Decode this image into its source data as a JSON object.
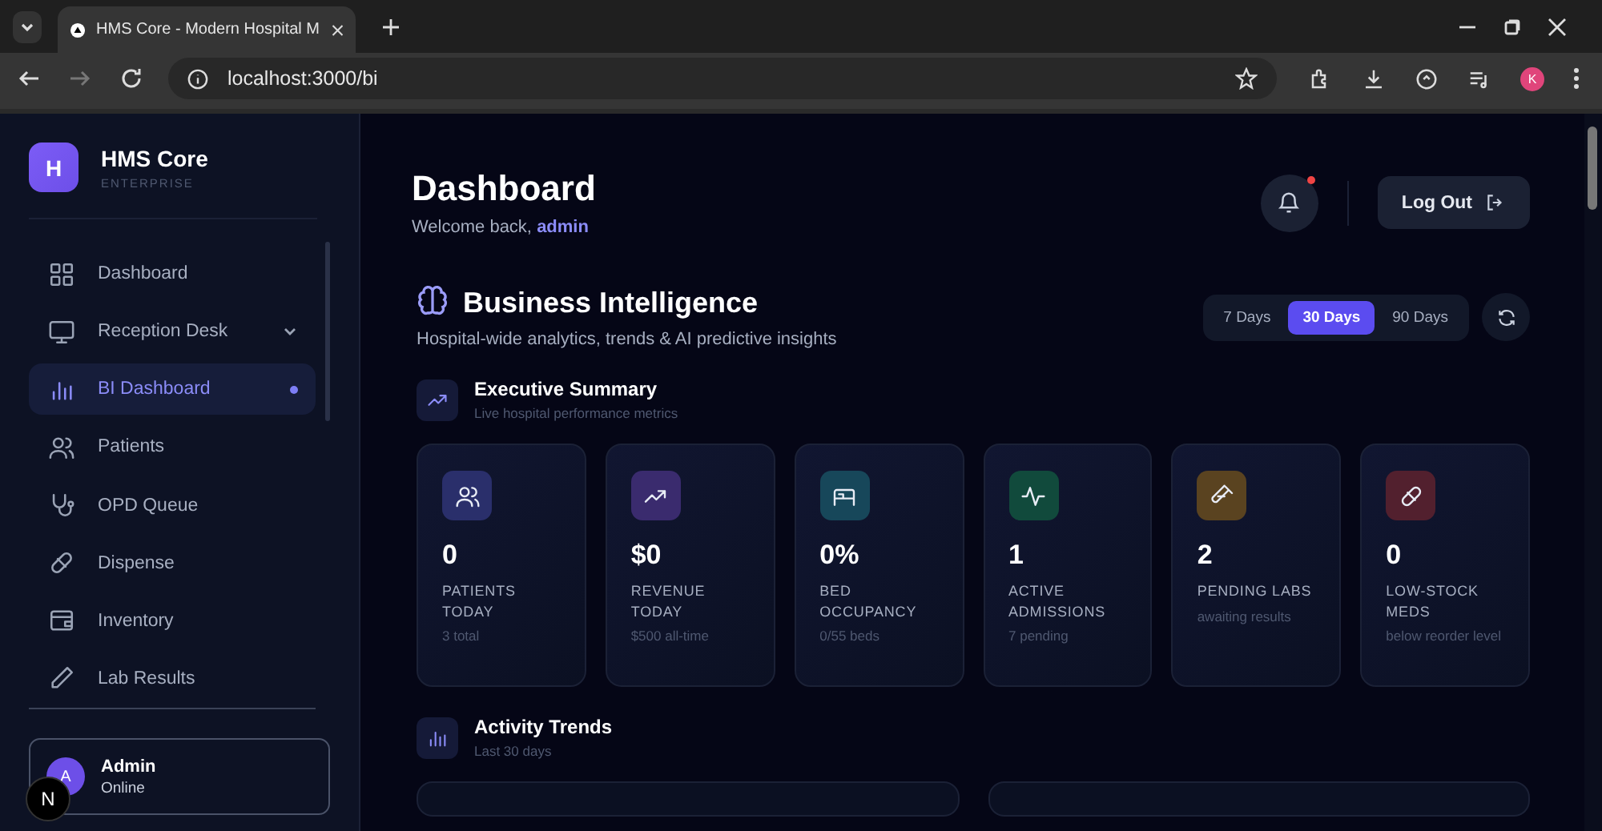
{
  "browser": {
    "tab_title": "HMS Core - Modern Hospital M",
    "url": "localhost:3000/bi",
    "profile_initial": "K"
  },
  "sidebar": {
    "logo_letter": "H",
    "brand": "HMS Core",
    "edition": "ENTERPRISE",
    "items": [
      {
        "label": "Dashboard",
        "selected": false,
        "expandable": false
      },
      {
        "label": "Reception Desk",
        "selected": false,
        "expandable": true
      },
      {
        "label": "BI Dashboard",
        "selected": true,
        "expandable": false
      },
      {
        "label": "Patients",
        "selected": false,
        "expandable": false
      },
      {
        "label": "OPD Queue",
        "selected": false,
        "expandable": false
      },
      {
        "label": "Dispense",
        "selected": false,
        "expandable": false
      },
      {
        "label": "Inventory",
        "selected": false,
        "expandable": false
      },
      {
        "label": "Lab Results",
        "selected": false,
        "expandable": false
      }
    ],
    "user": {
      "initial": "A",
      "name": "Admin",
      "status": "Online"
    },
    "dev_badge": "N"
  },
  "header": {
    "title": "Dashboard",
    "welcome": "Welcome back, ",
    "username": "admin",
    "notification": true,
    "logout": "Log Out"
  },
  "bi": {
    "title": "Business Intelligence",
    "subtitle": "Hospital-wide analytics, trends & AI predictive insights",
    "ranges": [
      {
        "label": "7 Days",
        "selected": false
      },
      {
        "label": "30 Days",
        "selected": true
      },
      {
        "label": "90 Days",
        "selected": false
      }
    ]
  },
  "executive_summary": {
    "title": "Executive Summary",
    "subtitle": "Live hospital performance metrics",
    "cards": [
      {
        "value": "0",
        "label": "PATIENTS TODAY",
        "note": "3 total"
      },
      {
        "value": "$0",
        "label": "REVENUE TODAY",
        "note": "$500 all-time"
      },
      {
        "value": "0%",
        "label": "BED OCCUPANCY",
        "note": "0/55 beds"
      },
      {
        "value": "1",
        "label": "ACTIVE ADMISSIONS",
        "note": "7 pending"
      },
      {
        "value": "2",
        "label": "PENDING LABS",
        "note": "awaiting results"
      },
      {
        "value": "0",
        "label": "LOW-STOCK MEDS",
        "note": "below reorder level"
      }
    ]
  },
  "activity_trends": {
    "title": "Activity Trends",
    "subtitle": "Last 30 days"
  }
}
